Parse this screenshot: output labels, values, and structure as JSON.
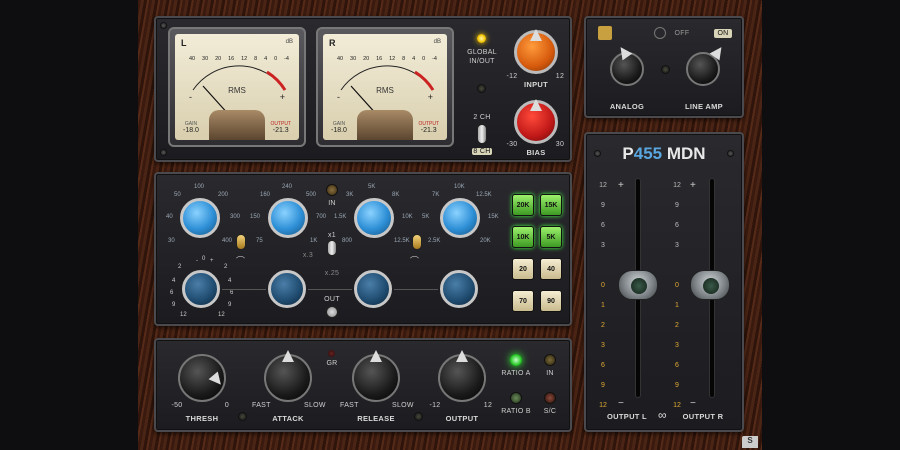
{
  "meters": [
    {
      "channel": "L",
      "unit": "dB",
      "mode": "RMS",
      "gain_label": "GAIN",
      "output_label": "OUTPUT",
      "gain_value": "-18.0",
      "output_value": "-21.3",
      "scale": [
        "40",
        "30",
        "20",
        "16",
        "12",
        "8",
        "4",
        "0",
        "-4"
      ]
    },
    {
      "channel": "R",
      "unit": "dB",
      "mode": "RMS",
      "gain_label": "GAIN",
      "output_label": "OUTPUT",
      "gain_value": "-18.0",
      "output_value": "-21.3",
      "scale": [
        "40",
        "30",
        "20",
        "16",
        "12",
        "8",
        "4",
        "0",
        "-4"
      ]
    }
  ],
  "meter_marks": {
    "minus": "-",
    "plus": "+"
  },
  "global": {
    "label_line1": "GLOBAL",
    "label_line2": "IN/OUT"
  },
  "input": {
    "label": "INPUT",
    "min": "-12",
    "max": "12",
    "color": "#e8731e"
  },
  "bias": {
    "label": "BIAS",
    "min": "-30",
    "max": "30",
    "color": "#d11f1f"
  },
  "channel_mode": {
    "top": "2 CH",
    "bottom": "8 CH"
  },
  "top_right": {
    "off": "OFF",
    "on": "ON",
    "analog_label": "ANALOG",
    "line_amp_label": "LINE AMP"
  },
  "eq": {
    "bands": [
      {
        "labels": [
          "50",
          "100",
          "200",
          "40",
          "300",
          "30",
          "400"
        ]
      },
      {
        "labels": [
          "160",
          "240",
          "500",
          "150",
          "700",
          "75",
          "1K"
        ]
      },
      {
        "labels": [
          "3K",
          "5K",
          "8K",
          "1.5K",
          "10K",
          "800",
          "12.5K"
        ]
      },
      {
        "labels": [
          "7K",
          "10K",
          "12.5K",
          "5K",
          "15K",
          "2.5K",
          "20K"
        ]
      }
    ],
    "gain_scale": [
      "-",
      "0",
      "+",
      "2",
      "2",
      "4",
      "4",
      "6",
      "6",
      "9",
      "9",
      "12",
      "12"
    ],
    "in_label": "IN",
    "x1_label": "x1",
    "x3_label": "x.3",
    "x25_label": "x.25",
    "out_label": "OUT",
    "filter_buttons": [
      {
        "label": "20K",
        "style": "green"
      },
      {
        "label": "15K",
        "style": "green"
      },
      {
        "label": "10K",
        "style": "green"
      },
      {
        "label": "5K",
        "style": "green"
      },
      {
        "label": "20",
        "style": "cream"
      },
      {
        "label": "40",
        "style": "cream"
      },
      {
        "label": "70",
        "style": "cream"
      },
      {
        "label": "90",
        "style": "cream"
      }
    ]
  },
  "comp": {
    "thresh": {
      "label": "THRESH",
      "min": "-50",
      "max": "0"
    },
    "attack": {
      "label": "ATTACK",
      "min": "FAST",
      "max": "SLOW"
    },
    "release": {
      "label": "RELEASE",
      "min": "FAST",
      "max": "SLOW"
    },
    "output": {
      "label": "OUTPUT",
      "min": "-12",
      "max": "12"
    },
    "gr_label": "GR",
    "ratio_a": "RATIO A",
    "ratio_b": "RATIO B",
    "in_label": "IN",
    "sc_label": "S/C"
  },
  "output_section": {
    "brand_p": "P",
    "brand_num": "455",
    "brand_rest": " MDN",
    "scale": [
      "12",
      "9",
      "6",
      "3",
      "0",
      "1",
      "2",
      "3",
      "6",
      "9",
      "12"
    ],
    "plus": "+",
    "minus": "−",
    "output_l": "OUTPUT L",
    "output_r": "OUTPUT R",
    "link_icon": "infinity-link-icon"
  }
}
